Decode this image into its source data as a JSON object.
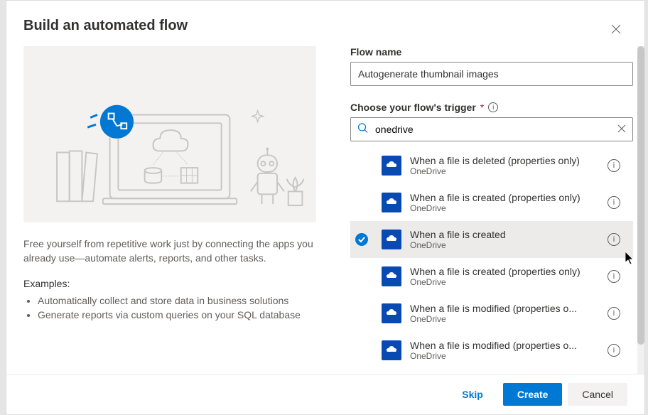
{
  "header": {
    "title": "Build an automated flow"
  },
  "left": {
    "description": "Free yourself from repetitive work just by connecting the apps you already use—automate alerts, reports, and other tasks.",
    "examples_label": "Examples:",
    "examples": [
      "Automatically collect and store data in business solutions",
      "Generate reports via custom queries on your SQL database"
    ]
  },
  "right": {
    "flow_name_label": "Flow name",
    "flow_name_value": "Autogenerate thumbnail images",
    "trigger_label": "Choose your flow's trigger",
    "search_value": "onedrive",
    "triggers": [
      {
        "title": "When a file is deleted (properties only)",
        "sub": "OneDrive",
        "selected": false,
        "icon": "onedrive-icon"
      },
      {
        "title": "When a file is created (properties only)",
        "sub": "OneDrive",
        "selected": false,
        "icon": "onedrive-icon"
      },
      {
        "title": "When a file is created",
        "sub": "OneDrive",
        "selected": true,
        "icon": "onedrive-icon"
      },
      {
        "title": "When a file is created (properties only)",
        "sub": "OneDrive",
        "selected": false,
        "icon": "onedrive-icon"
      },
      {
        "title": "When a file is modified (properties o...",
        "sub": "OneDrive",
        "selected": false,
        "icon": "onedrive-icon"
      },
      {
        "title": "When a file is modified (properties o...",
        "sub": "OneDrive",
        "selected": false,
        "icon": "onedrive-icon"
      }
    ]
  },
  "footer": {
    "skip": "Skip",
    "create": "Create",
    "cancel": "Cancel"
  }
}
